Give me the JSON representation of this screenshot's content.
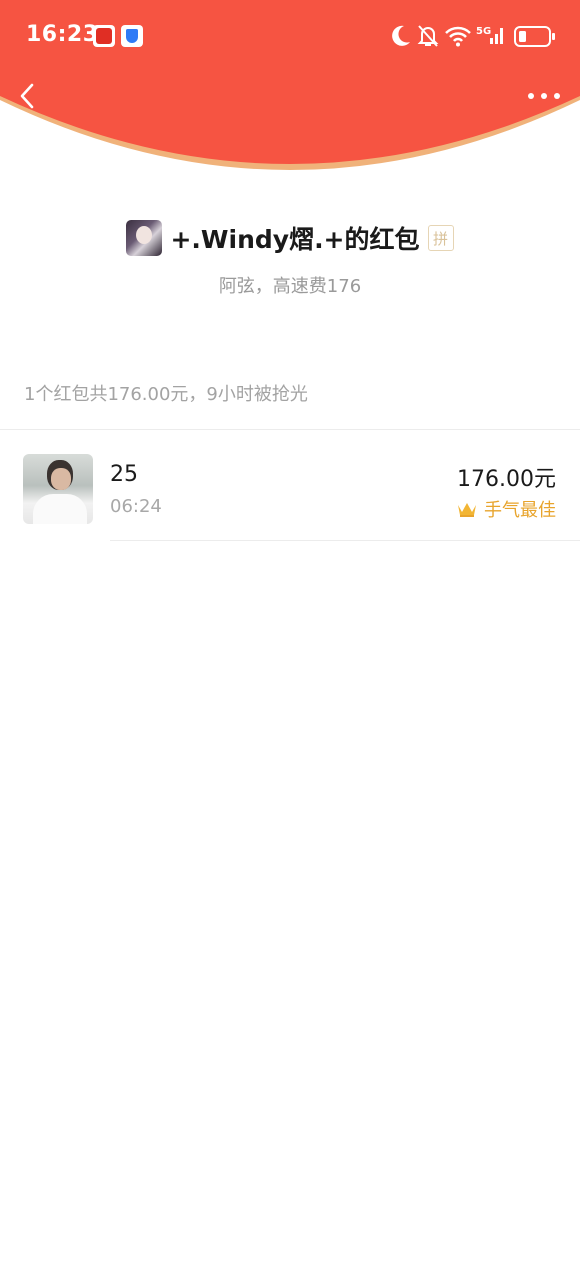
{
  "status_bar": {
    "time": "16:23",
    "app_icons": [
      "pinduoduo-icon",
      "shield-icon"
    ],
    "system_icons": [
      "moon-icon",
      "bell-off-icon",
      "wifi-icon",
      "signal-5g-icon",
      "battery-icon"
    ]
  },
  "colors": {
    "header_red": "#f65442",
    "gold": "#e8a42c",
    "muted_text": "#a3a3a3"
  },
  "sender": {
    "name": "+.Windy熠.+的红包",
    "pin_badge": "拼",
    "greeting": "阿弦，高速费176"
  },
  "summary": "1个红包共176.00元，9小时被抢光",
  "records": [
    {
      "name": "25",
      "time": "06:24",
      "amount": "176.00元",
      "best_label": "手气最佳"
    }
  ]
}
